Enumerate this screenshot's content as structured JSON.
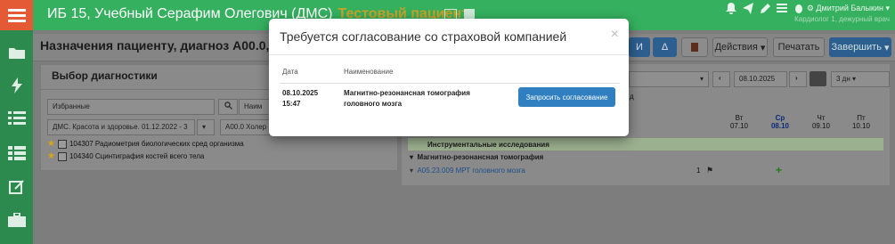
{
  "header": {
    "patient": "ИБ 15, Учебный Серафим Олегович (ДМС)",
    "test_badge": "Тестовый пациент",
    "user_name": "Дмитрий Балыкин",
    "user_sub": "Кардиолог 1, дежурный врач"
  },
  "page": {
    "title": "Назначения пациенту, диагноз А00.0, с"
  },
  "toolbar": {
    "actions_label": "Действия",
    "print_label": "Печатать",
    "finish_label": "Завершить",
    "delta_label": "Δ",
    "btn1_label": "И"
  },
  "diagnostics_panel": {
    "title": "Выбор диагностики",
    "favorites_value": "Избранные",
    "name_placeholder": "Наим",
    "contract_value": "ДМС. Красота и здоровье. 01.12.2022 - 3",
    "diagnosis_value": "А00.0 Холер",
    "items": [
      {
        "code": "104307",
        "label": "104307 Радиометрия биологических сред организма"
      },
      {
        "code": "104340",
        "label": "104340 Сцинтиграфия костей всего тела"
      }
    ]
  },
  "schedule_panel": {
    "date_value": "08.10.2025",
    "period_value": "3 дн",
    "partial_label": "д",
    "days": [
      {
        "dow": "Вт",
        "date": "07.10",
        "current": false
      },
      {
        "dow": "Ср",
        "date": "08.10",
        "current": true
      },
      {
        "dow": "Чт",
        "date": "09.10",
        "current": false
      },
      {
        "dow": "Пт",
        "date": "10.10",
        "current": false
      }
    ],
    "group_label": "Инструментальные исследования",
    "subgroup_label": "Магнитно-резонансная томография",
    "row_label": "А05.23.009 МРТ головного мозга",
    "row_count": "1"
  },
  "modal": {
    "title": "Требуется согласование со страховой компанией",
    "close_glyph": "×",
    "col_date": "Дата",
    "col_name": "Наименование",
    "row_date": "08.10.2025",
    "row_time": "15:47",
    "row_name_line1": "Магнитно-резонансная томография",
    "row_name_line2": "головного мозга",
    "request_button": "Запросить согласование"
  },
  "colors": {
    "header_green": "#35b05f",
    "sidebar_green": "#2c8a4f",
    "menu_orange": "#e45a34",
    "primary_blue": "#2f7fc1"
  },
  "icons": [
    "menu-icon",
    "folder-icon",
    "bolt-icon",
    "list-icon",
    "table-icon",
    "edit-icon",
    "briefcase-icon",
    "bell-icon",
    "send-icon",
    "pencil-icon",
    "tasks-icon",
    "bug-icon",
    "gear-icon",
    "calendar-icon",
    "search-icon",
    "star-icon",
    "plus-icon",
    "flag-icon"
  ]
}
